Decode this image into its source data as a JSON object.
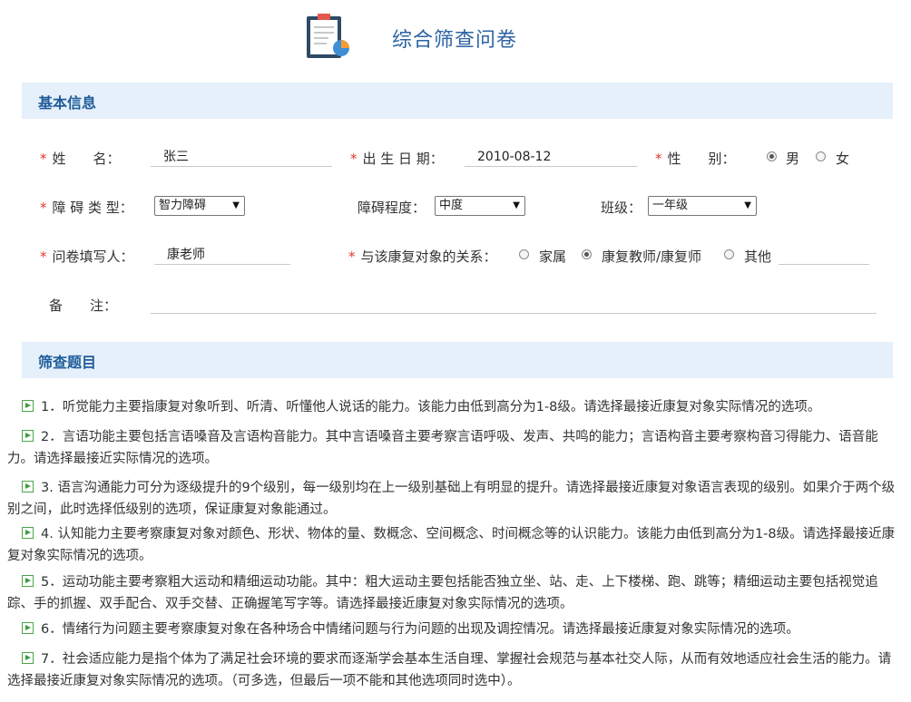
{
  "header": {
    "title": "综合筛查问卷",
    "icon": "clipboard-chart-icon"
  },
  "sections": {
    "basic": "基本信息",
    "screening": "筛查题目"
  },
  "form": {
    "name": {
      "required": "*",
      "label": "姓　　名：",
      "value": "张三"
    },
    "birth": {
      "required": "*",
      "label": "出 生 日 期：",
      "value": "2010-08-12"
    },
    "gender": {
      "required": "*",
      "label": "性　　别：",
      "options": [
        "男",
        "女"
      ],
      "selected": "男"
    },
    "disability_type": {
      "required": "*",
      "label": "障 碍 类 型：",
      "value": "智力障碍"
    },
    "disability_level": {
      "label": "障碍程度：",
      "value": "中度"
    },
    "class": {
      "label": "班级：",
      "value": "一年级"
    },
    "filler": {
      "required": "*",
      "label": "问卷填写人：",
      "value": "康老师"
    },
    "relation": {
      "required": "*",
      "label": "与该康复对象的关系：",
      "options": [
        "家属",
        "康复教师/康复师",
        "其他"
      ],
      "selected": "康复教师/康复师",
      "other_value": ""
    },
    "remark": {
      "label": "备　　注：",
      "value": ""
    }
  },
  "questions": [
    "1．听觉能力主要指康复对象听到、听清、听懂他人说话的能力。该能力由低到高分为1-8级。请选择最接近康复对象实际情况的选项。",
    "2．言语功能主要包括言语嗓音及言语构音能力。其中言语嗓音主要考察言语呼吸、发声、共鸣的能力；言语构音主要考察构音习得能力、语音能力。请选择最接近实际情况的选项。",
    "3. 语言沟通能力可分为逐级提升的9个级别，每一级别均在上一级别基础上有明显的提升。请选择最接近康复对象语言表现的级别。如果介于两个级别之间，此时选择低级别的选项，保证康复对象能通过。",
    "4. 认知能力主要考察康复对象对颜色、形状、物体的量、数概念、空间概念、时间概念等的认识能力。该能力由低到高分为1-8级。请选择最接近康复对象实际情况的选项。",
    "5．运动功能主要考察粗大运动和精细运动功能。其中：粗大运动主要包括能否独立坐、站、走、上下楼梯、跑、跳等；精细运动主要包括视觉追踪、手的抓握、双手配合、双手交替、正确握笔写字等。请选择最接近康复对象实际情况的选项。",
    "6．情绪行为问题主要考察康复对象在各种场合中情绪问题与行为问题的出现及调控情况。请选择最接近康复对象实际情况的选项。",
    "7．社会适应能力是指个体为了满足社会环境的要求而逐渐学会基本生活自理、掌握社会规范与基本社交人际，从而有效地适应社会生活的能力。请选择最接近康复对象实际情况的选项。（可多选，但最后一项不能和其他选项同时选中）。"
  ],
  "colors": {
    "title": "#2d63a3",
    "section_bg": "#e5f0fb",
    "section_text": "#1f5c99",
    "required": "#e0392b",
    "play_icon": "#3b9b3b"
  }
}
